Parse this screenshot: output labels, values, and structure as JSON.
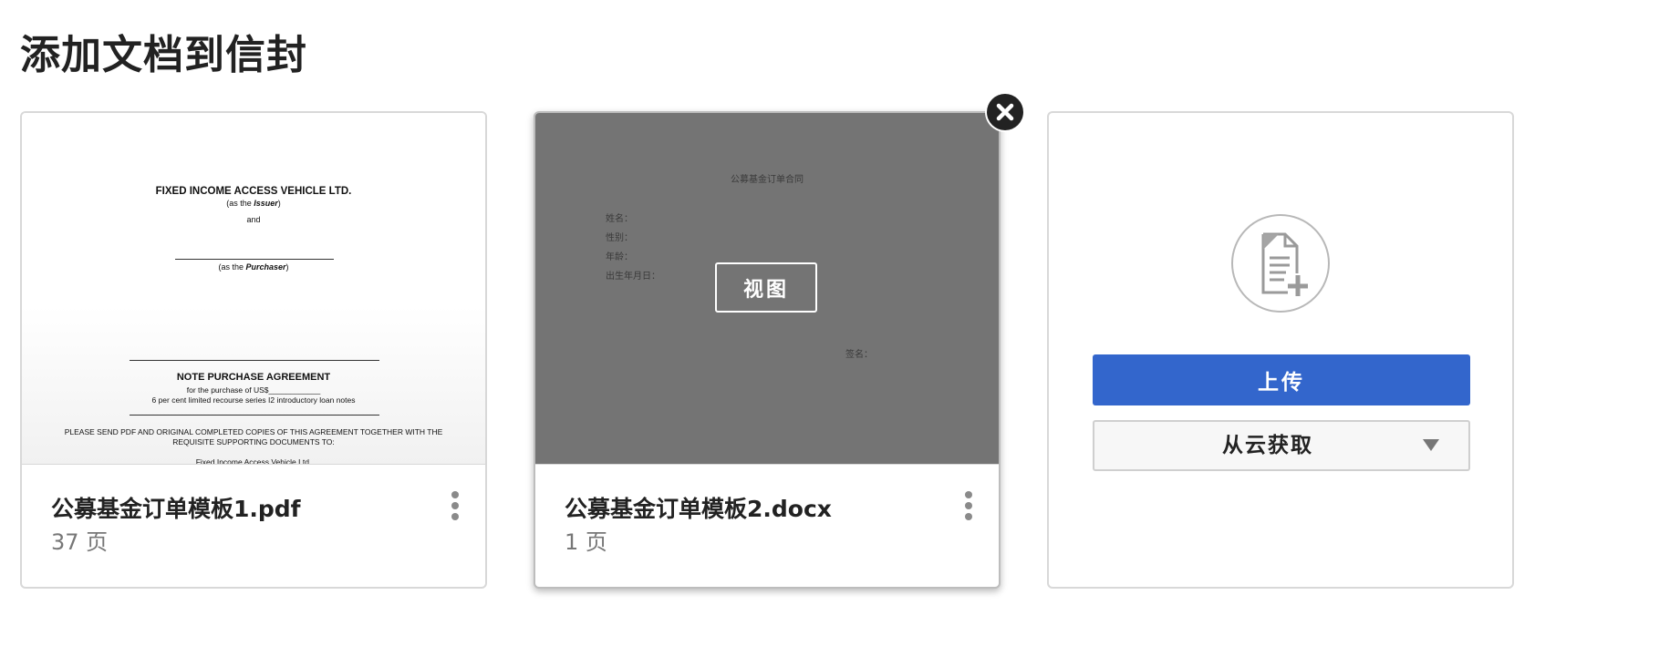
{
  "page_title": "添加文档到信封",
  "documents": [
    {
      "name": "公募基金订单模板1.pdf",
      "pages": "37 页",
      "preview": {
        "company": "FIXED INCOME ACCESS VEHICLE LTD.",
        "as_issuer_pre": "(as the ",
        "as_issuer_em": "Issuer",
        "as_issuer_post": ")",
        "and": "and",
        "as_purchaser_pre": "(as the ",
        "as_purchaser_em": "Purchaser",
        "as_purchaser_post": ")",
        "agreement_title": "NOTE PURCHASE AGREEMENT",
        "purchase_line": "for the purchase of US$____________",
        "notes_line": "6 per cent limited recourse series I2 introductory  loan notes",
        "send_line_1": "PLEASE SEND PDF AND ORIGINAL COMPLETED COPIES OF THIS AGREEMENT TOGETHER WITH THE",
        "send_line_2": "REQUISITE SUPPORTING DOCUMENTS TO:",
        "cut_line": "Fixed Income Access Vehicle Ltd."
      }
    },
    {
      "name": "公募基金订单模板2.docx",
      "pages": "1 页",
      "preview": {
        "title": "公募基金订单合同",
        "field_name": "姓名：",
        "field_gender": "性别：",
        "field_age": "年龄：",
        "field_birth": "出生年月日：",
        "signature": "签名："
      },
      "view_label": "视图"
    }
  ],
  "upload": {
    "upload_label": "上传",
    "cloud_label": "从云获取"
  },
  "icons": {
    "kebab": "more-vertical-icon",
    "close": "close-icon",
    "add_document": "add-document-icon",
    "dropdown": "caret-down-icon"
  },
  "colors": {
    "upload_button": "#3366cc",
    "selected_overlay": "#747474",
    "close_button": "#222222"
  }
}
